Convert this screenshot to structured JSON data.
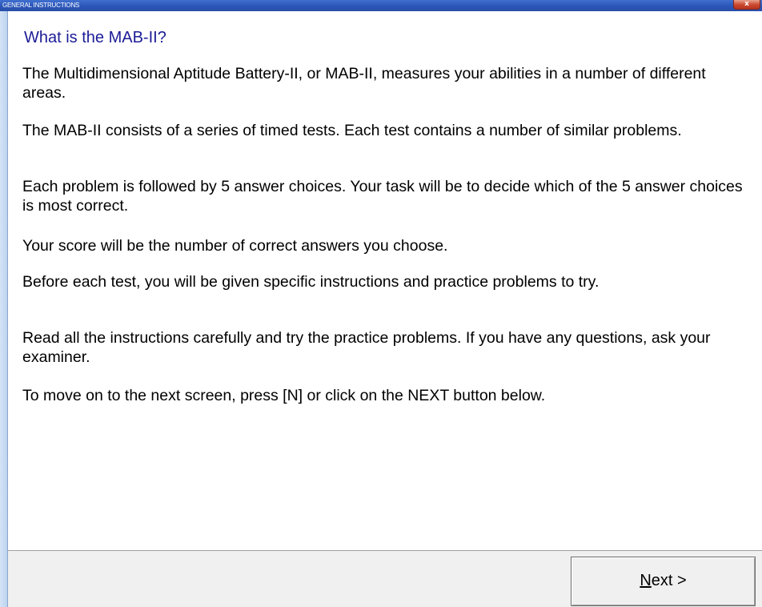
{
  "window": {
    "title": "GENERAL INSTRUCTIONS",
    "close_label": "x"
  },
  "content": {
    "heading": "What is the MAB-II?",
    "paragraphs": [
      "The Multidimensional Aptitude Battery-II, or MAB-II, measures your abilities in a number of different areas.",
      "The MAB-II consists of a series of timed tests. Each test contains a number of similar problems.",
      "Each problem is followed by 5 answer choices. Your task will be to decide which of the 5 answer choices is most correct.",
      "Your score will be the number of correct answers you choose.",
      "Before each test, you will be given specific instructions and practice problems to try.",
      "Read all the instructions carefully and try the practice problems. If you have any questions, ask your examiner.",
      "To move on to the next screen, press [N] or click on the NEXT button below."
    ]
  },
  "footer": {
    "next_accel": "N",
    "next_rest": "ext >"
  },
  "colors": {
    "heading": "#1c1c96",
    "titlebar": "#2b56b8",
    "footer_bg": "#f0f0f0"
  }
}
